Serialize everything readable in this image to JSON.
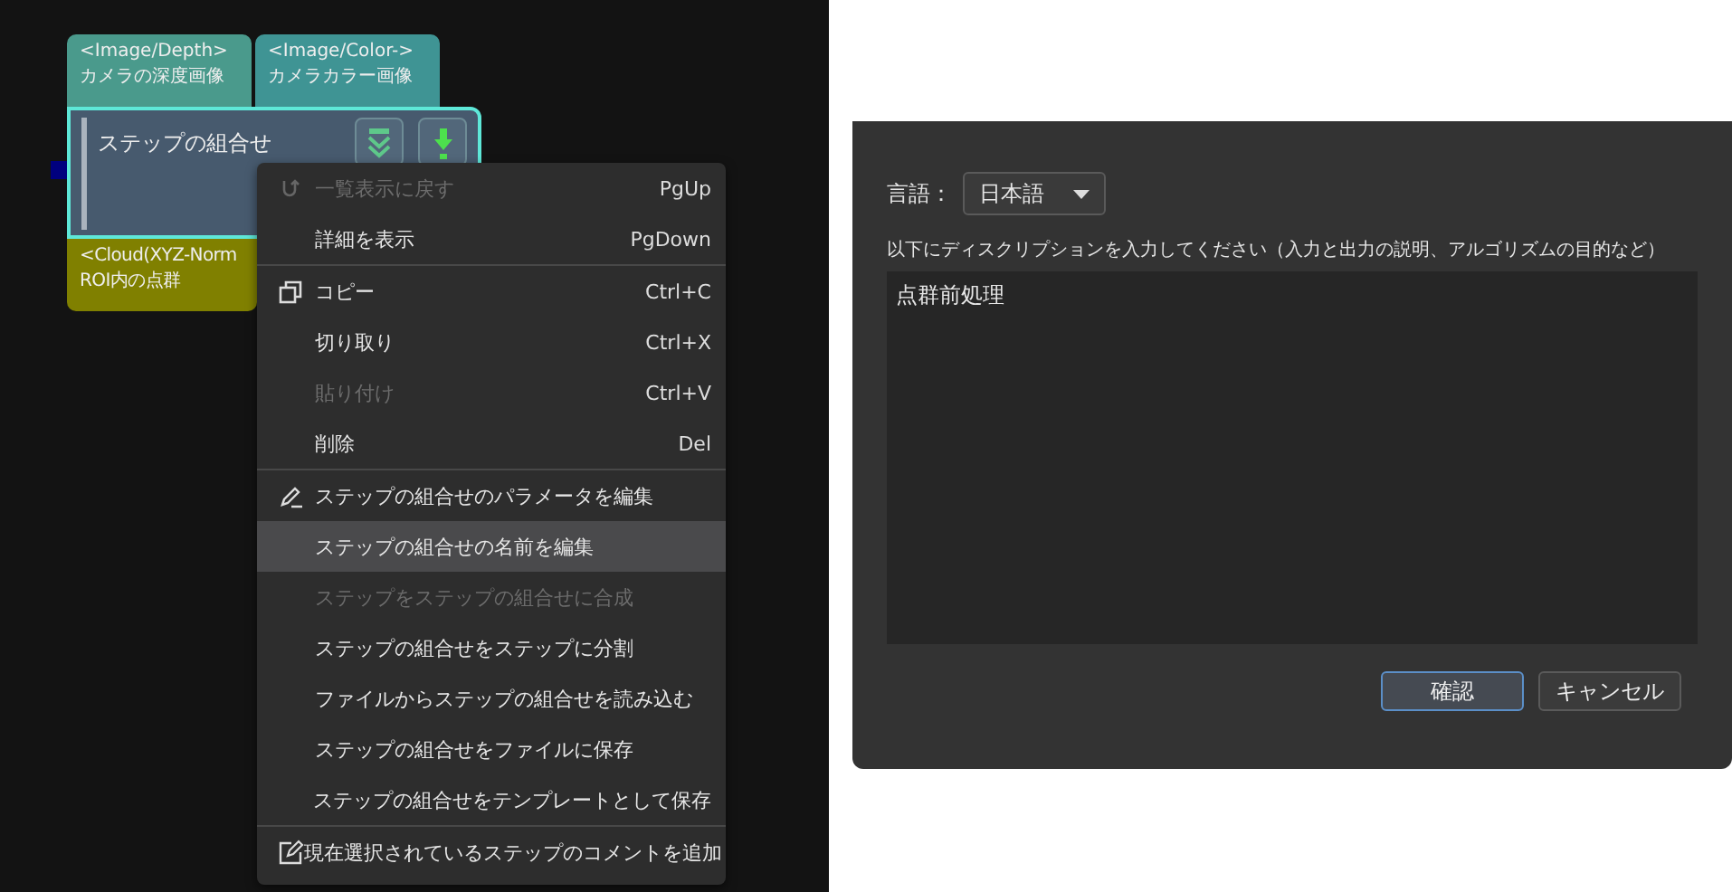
{
  "node_graph": {
    "node": {
      "title": "ステップの組合せ",
      "selected": true,
      "inputs": [
        {
          "type": "<Image/Depth>",
          "label": "カメラの深度画像",
          "color": "#4a9a8c"
        },
        {
          "type": "<Image/Color->",
          "label": "カメラカラー画像",
          "color": "#3f9494"
        }
      ],
      "outputs": [
        {
          "type": "<Cloud(XYZ-Norm",
          "label": "ROI内の点群",
          "color": "#808000"
        }
      ]
    }
  },
  "context_menu": {
    "items": [
      {
        "kind": "item",
        "label": "一覧表示に戻す",
        "shortcut": "PgUp",
        "disabled": true,
        "selected": false
      },
      {
        "kind": "item",
        "label": "詳細を表示",
        "shortcut": "PgDown",
        "disabled": false,
        "selected": false
      },
      {
        "kind": "separator"
      },
      {
        "kind": "item",
        "label": "コピー",
        "shortcut": "Ctrl+C",
        "disabled": false,
        "selected": false
      },
      {
        "kind": "item",
        "label": "切り取り",
        "shortcut": "Ctrl+X",
        "disabled": false,
        "selected": false
      },
      {
        "kind": "item",
        "label": "貼り付け",
        "shortcut": "Ctrl+V",
        "disabled": true,
        "selected": false
      },
      {
        "kind": "item",
        "label": "削除",
        "shortcut": "Del",
        "disabled": false,
        "selected": false
      },
      {
        "kind": "separator"
      },
      {
        "kind": "item",
        "label": "ステップの組合せのパラメータを編集",
        "disabled": false,
        "selected": false
      },
      {
        "kind": "item",
        "label": "ステップの組合せの名前を編集",
        "disabled": false,
        "selected": true
      },
      {
        "kind": "item",
        "label": "ステップをステップの組合せに合成",
        "disabled": true,
        "selected": false
      },
      {
        "kind": "item",
        "label": "ステップの組合せをステップに分割",
        "disabled": false,
        "selected": false
      },
      {
        "kind": "item",
        "label": "ファイルからステップの組合せを読み込む",
        "disabled": false,
        "selected": false
      },
      {
        "kind": "item",
        "label": "ステップの組合せをファイルに保存",
        "disabled": false,
        "selected": false
      },
      {
        "kind": "item",
        "label": "ステップの組合せをテンプレートとして保存",
        "disabled": false,
        "selected": false
      },
      {
        "kind": "separator"
      },
      {
        "kind": "item",
        "label": "現在選択されているステップのコメントを追加",
        "disabled": false,
        "selected": false
      }
    ]
  },
  "dialog": {
    "language_label": "言語：",
    "language": "日本語",
    "prompt": "以下にディスクリプションを入力してください（入力と出力の説明、アルゴリズムの目的など）",
    "description": "点群前処理",
    "buttons": [
      {
        "label": "確認",
        "default": true
      },
      {
        "label": "キャンセル",
        "default": false
      }
    ]
  }
}
